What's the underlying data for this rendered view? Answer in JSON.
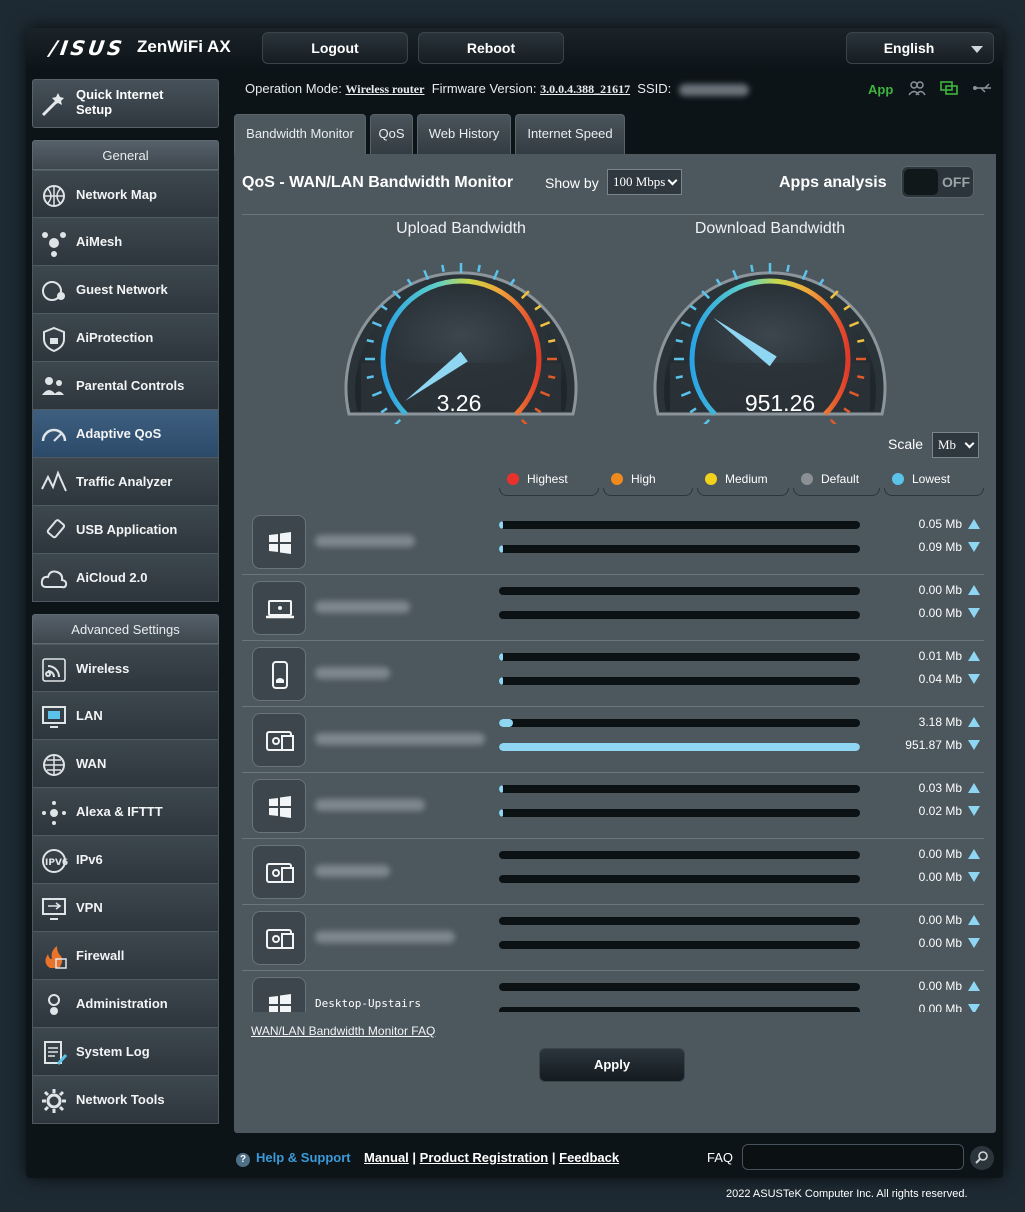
{
  "header": {
    "brand": "/ISUS",
    "model": "ZenWiFi AX",
    "logout": "Logout",
    "reboot": "Reboot",
    "language": "English"
  },
  "info": {
    "op_mode_label": "Operation Mode:",
    "op_mode": "Wireless router",
    "fw_label": "Firmware Version:",
    "fw": "3.0.0.4.388_21617",
    "ssid_label": "SSID:",
    "app": "App"
  },
  "sidebar": {
    "qis": "Quick Internet Setup",
    "general_title": "General",
    "general": [
      {
        "label": "Network Map",
        "icon": "network-map-icon"
      },
      {
        "label": "AiMesh",
        "icon": "aimesh-icon"
      },
      {
        "label": "Guest Network",
        "icon": "guest-network-icon"
      },
      {
        "label": "AiProtection",
        "icon": "aiprotection-icon"
      },
      {
        "label": "Parental Controls",
        "icon": "parental-controls-icon"
      },
      {
        "label": "Adaptive QoS",
        "icon": "adaptive-qos-icon"
      },
      {
        "label": "Traffic Analyzer",
        "icon": "traffic-analyzer-icon"
      },
      {
        "label": "USB Application",
        "icon": "usb-application-icon"
      },
      {
        "label": "AiCloud 2.0",
        "icon": "aicloud-icon"
      }
    ],
    "advanced_title": "Advanced Settings",
    "advanced": [
      {
        "label": "Wireless",
        "icon": "wireless-icon"
      },
      {
        "label": "LAN",
        "icon": "lan-icon"
      },
      {
        "label": "WAN",
        "icon": "wan-icon"
      },
      {
        "label": "Alexa & IFTTT",
        "icon": "alexa-icon"
      },
      {
        "label": "IPv6",
        "icon": "ipv6-icon"
      },
      {
        "label": "VPN",
        "icon": "vpn-icon"
      },
      {
        "label": "Firewall",
        "icon": "firewall-icon"
      },
      {
        "label": "Administration",
        "icon": "administration-icon"
      },
      {
        "label": "System Log",
        "icon": "system-log-icon"
      },
      {
        "label": "Network Tools",
        "icon": "network-tools-icon"
      }
    ]
  },
  "tabs": [
    "Bandwidth Monitor",
    "QoS",
    "Web History",
    "Internet Speed"
  ],
  "panel": {
    "title": "QoS - WAN/LAN Bandwidth Monitor",
    "show_by_label": "Show by",
    "show_by": "100 Mbps",
    "apps_analysis": "Apps analysis",
    "toggle": "OFF",
    "upload_title": "Upload Bandwidth",
    "download_title": "Download Bandwidth",
    "upload_value": "3.26",
    "download_value": "951.26",
    "upload_needle_fraction": 0.03,
    "download_needle_fraction": 0.3,
    "scale_label": "Scale",
    "scale": "Mb",
    "legend": [
      {
        "label": "Highest",
        "color": "#e8322b"
      },
      {
        "label": "High",
        "color": "#f08a1c"
      },
      {
        "label": "Medium",
        "color": "#f2d21b"
      },
      {
        "label": "Default",
        "color": "#8a9094"
      },
      {
        "label": "Lowest",
        "color": "#5bc3ea"
      }
    ],
    "devices": [
      {
        "icon": "windows",
        "name": "",
        "up": "0.05 Mb",
        "down": "0.09 Mb",
        "up_frac": 0.005,
        "down_frac": 0.008
      },
      {
        "icon": "laptop",
        "name": "",
        "up": "0.00 Mb",
        "down": "0.00 Mb",
        "up_frac": 0,
        "down_frac": 0
      },
      {
        "icon": "phone",
        "name": "",
        "up": "0.01 Mb",
        "down": "0.04 Mb",
        "up_frac": 0.004,
        "down_frac": 0.005
      },
      {
        "icon": "device",
        "name": "",
        "up": "3.18 Mb",
        "down": "951.87 Mb",
        "up_frac": 0.04,
        "down_frac": 1.0
      },
      {
        "icon": "windows",
        "name": "",
        "up": "0.03 Mb",
        "down": "0.02 Mb",
        "up_frac": 0.004,
        "down_frac": 0.004
      },
      {
        "icon": "device",
        "name": "",
        "up": "0.00 Mb",
        "down": "0.00 Mb",
        "up_frac": 0,
        "down_frac": 0
      },
      {
        "icon": "device",
        "name": "",
        "up": "0.00 Mb",
        "down": "0.00 Mb",
        "up_frac": 0,
        "down_frac": 0
      },
      {
        "icon": "windows",
        "name": "Desktop-Upstairs",
        "up": "0.00 Mb",
        "down": "0.00 Mb",
        "up_frac": 0,
        "down_frac": 0
      }
    ],
    "faq_link": "WAN/LAN Bandwidth Monitor FAQ",
    "apply": "Apply"
  },
  "footer": {
    "help": "Help & Support",
    "manual": "Manual",
    "registration": "Product Registration",
    "feedback": "Feedback",
    "faq": "FAQ",
    "copyright": "2022 ASUSTeK Computer Inc. All rights reserved."
  }
}
